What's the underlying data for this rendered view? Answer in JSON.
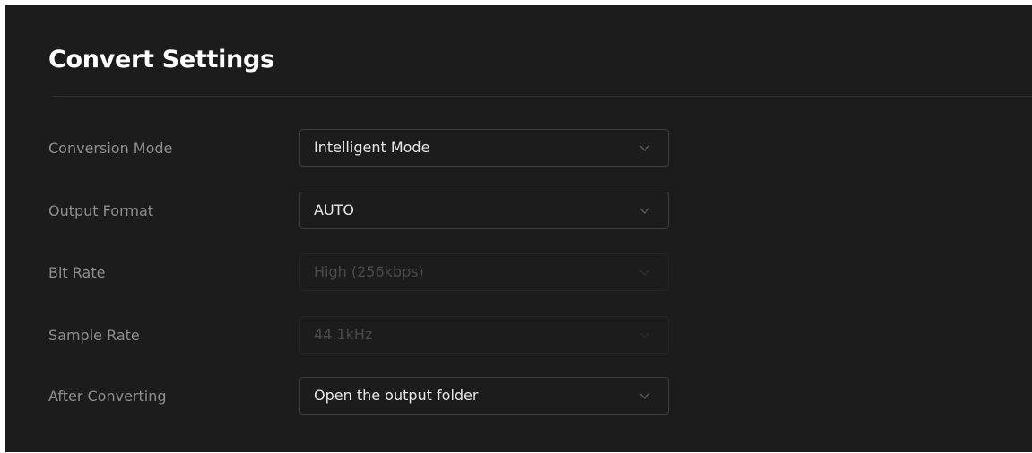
{
  "header": {
    "title": "Convert Settings"
  },
  "settings": [
    {
      "label": "Conversion Mode",
      "value": "Intelligent Mode",
      "enabled": true
    },
    {
      "label": "Output Format",
      "value": "AUTO",
      "enabled": true
    },
    {
      "label": "Bit Rate",
      "value": "High (256kbps)",
      "enabled": false
    },
    {
      "label": "Sample Rate",
      "value": "44.1kHz",
      "enabled": false
    },
    {
      "label": "After Converting",
      "value": "Open the output folder",
      "enabled": true
    }
  ],
  "icons": {
    "dropdown": "chevron-down-icon"
  },
  "colors": {
    "background": "#1c1c1c",
    "title": "#ffffff",
    "label": "#8e8e8e",
    "value": "#e6e6e6",
    "disabled_value": "#4a4a4a",
    "border": "#3c3c3c"
  }
}
